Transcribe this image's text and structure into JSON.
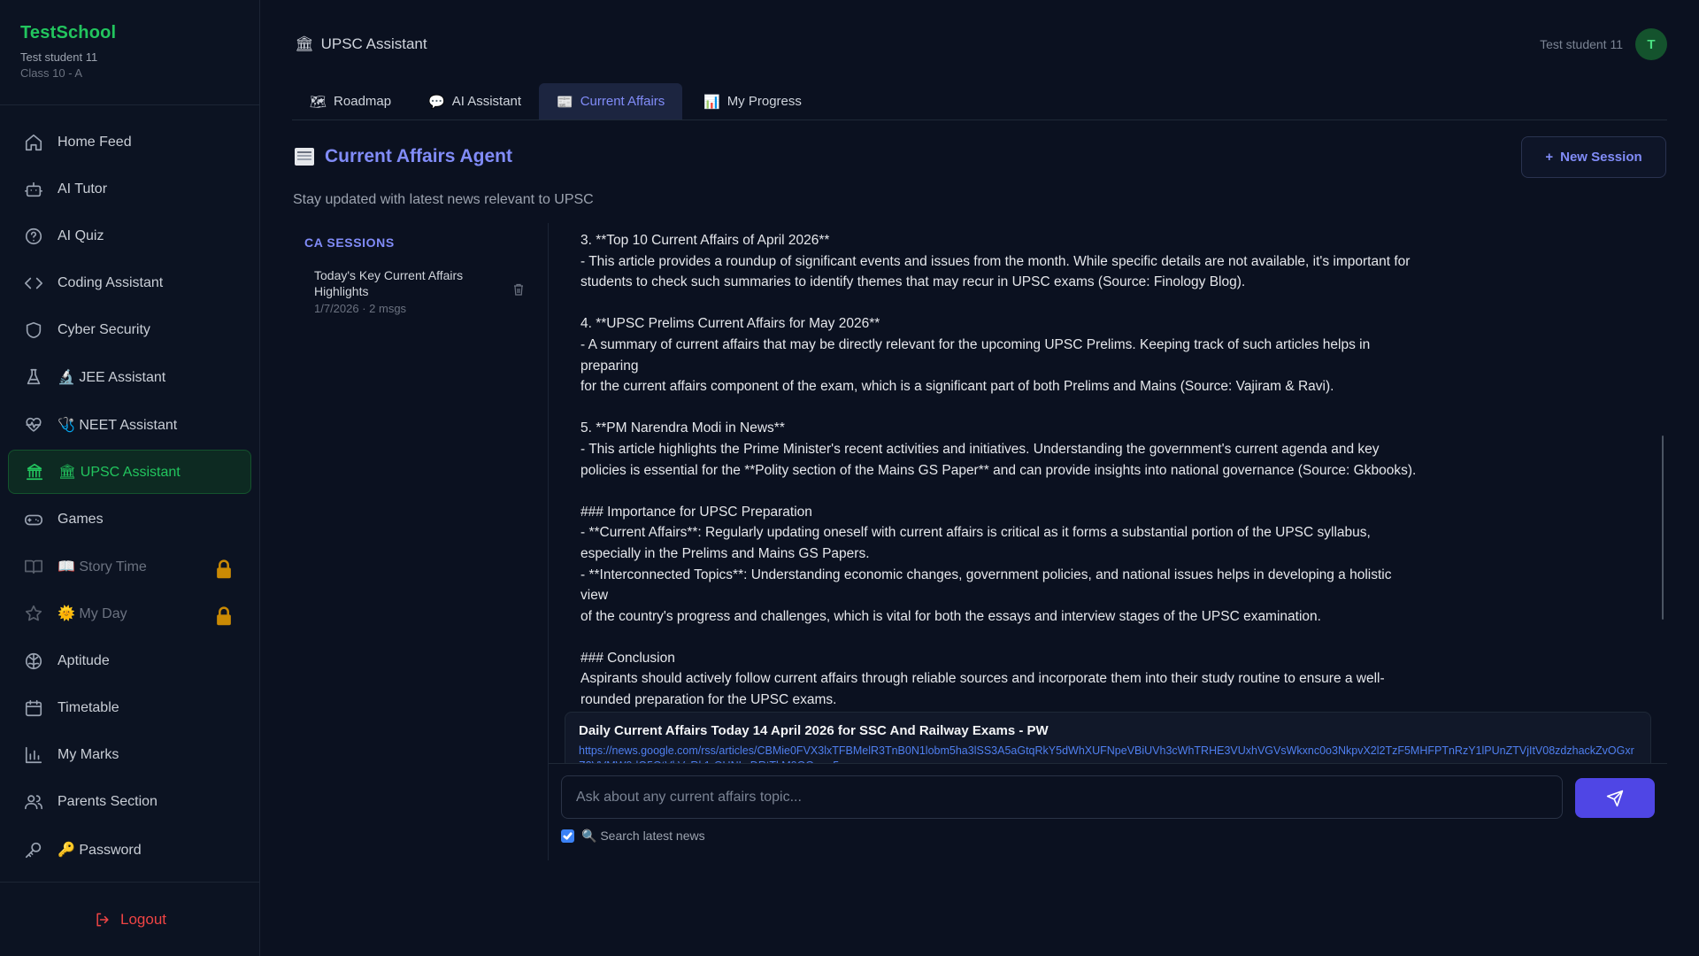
{
  "brand": {
    "name": "TestSchool",
    "user": "Test student 11",
    "class": "Class 10 - A"
  },
  "sidebar": {
    "items": [
      {
        "label": "Home Feed",
        "icon": "home-icon"
      },
      {
        "label": "AI Tutor",
        "icon": "robot-icon"
      },
      {
        "label": "AI Quiz",
        "icon": "help-circle-icon"
      },
      {
        "label": "Coding Assistant",
        "icon": "code-icon"
      },
      {
        "label": "Cyber Security",
        "icon": "shield-icon"
      },
      {
        "label": "🔬 JEE Assistant",
        "icon": "flask-icon"
      },
      {
        "label": "🩺 NEET Assistant",
        "icon": "heart-pulse-icon"
      },
      {
        "label": "🏛 UPSC Assistant",
        "icon": "landmark-icon"
      },
      {
        "label": "Games",
        "icon": "gamepad-icon"
      },
      {
        "label": "📖 Story Time",
        "icon": "book-icon"
      },
      {
        "label": "🌞 My Day",
        "icon": "star-icon"
      },
      {
        "label": "Aptitude",
        "icon": "brain-icon"
      },
      {
        "label": "Timetable",
        "icon": "calendar-icon"
      },
      {
        "label": "My Marks",
        "icon": "bar-chart-icon"
      },
      {
        "label": "Parents Section",
        "icon": "users-icon"
      },
      {
        "label": "🔑 Password",
        "icon": "key-icon"
      }
    ],
    "logout": "Logout"
  },
  "header": {
    "title": "UPSC Assistant",
    "user_name": "Test student 11",
    "avatar_initial": "T"
  },
  "tabs": [
    {
      "label": "Roadmap"
    },
    {
      "label": "AI Assistant"
    },
    {
      "label": "Current Affairs"
    },
    {
      "label": "My Progress"
    }
  ],
  "agent": {
    "title": "Current Affairs Agent",
    "subtitle": "Stay updated with latest news relevant to UPSC",
    "new_session": "New Session"
  },
  "sessions": {
    "heading": "CA SESSIONS",
    "items": [
      {
        "title": "Today's Key Current Affairs Highlights",
        "meta": "1/7/2026 · 2 msgs"
      }
    ]
  },
  "message": {
    "lines": [
      "3. **Top 10 Current Affairs of April 2026**",
      "- This article provides a roundup of significant events and issues from the month. While specific details are not available, it's important for",
      "students to check such summaries to identify themes that may recur in UPSC exams (Source: Finology Blog).",
      "",
      "4. **UPSC Prelims Current Affairs for May 2026**",
      "- A summary of current affairs that may be directly relevant for the upcoming UPSC Prelims. Keeping track of such articles helps in preparing",
      "for the current affairs component of the exam, which is a significant part of both Prelims and Mains (Source: Vajiram & Ravi).",
      "",
      "5. **PM Narendra Modi in News**",
      "- This article highlights the Prime Minister's recent activities and initiatives. Understanding the government's current agenda and key",
      "policies is essential for the **Polity section of the Mains GS Paper** and can provide insights into national governance (Source: Gkbooks).",
      "",
      "### Importance for UPSC Preparation",
      "- **Current Affairs**: Regularly updating oneself with current affairs is critical as it forms a substantial portion of the UPSC syllabus,",
      "especially in the Prelims and Mains GS Papers.",
      "- **Interconnected Topics**: Understanding economic changes, government policies, and national issues helps in developing a holistic view",
      "of the country's progress and challenges, which is vital for both the essays and interview stages of the UPSC examination.",
      "",
      "### Conclusion",
      "Aspirants should actively follow current affairs through reliable sources and incorporate them into their study routine to ensure a well-",
      "rounded preparation for the UPSC exams."
    ]
  },
  "source": {
    "title": "Daily Current Affairs Today 14 April 2026 for SSC And Railway Exams - PW",
    "url": "https://news.google.com/rss/articles/CBMie0FVX3lxTFBMelR3TnB0N1lobm5ha3lSS3A5aGtqRkY5dWhXUFNpeVBiUVh3cWhTRHE3VUxhVGVsWkxnc0o3NkpvX2l2TzF5MHFPTnRzY1lPUnZTVjItV08zdzhackZvOGxrZ2VVMW9dQ5QtVkVsRk1rQUNLcDRtTkM0OGoe=5"
  },
  "input": {
    "placeholder": "Ask about any current affairs topic..."
  },
  "search_toggle": {
    "label": "🔍 Search latest news",
    "checked": true
  },
  "colors": {
    "brand": "#22c55e",
    "accent": "#818cf8",
    "send": "#4f46e5",
    "logout": "#ef4444",
    "link": "#4f7ff0"
  }
}
